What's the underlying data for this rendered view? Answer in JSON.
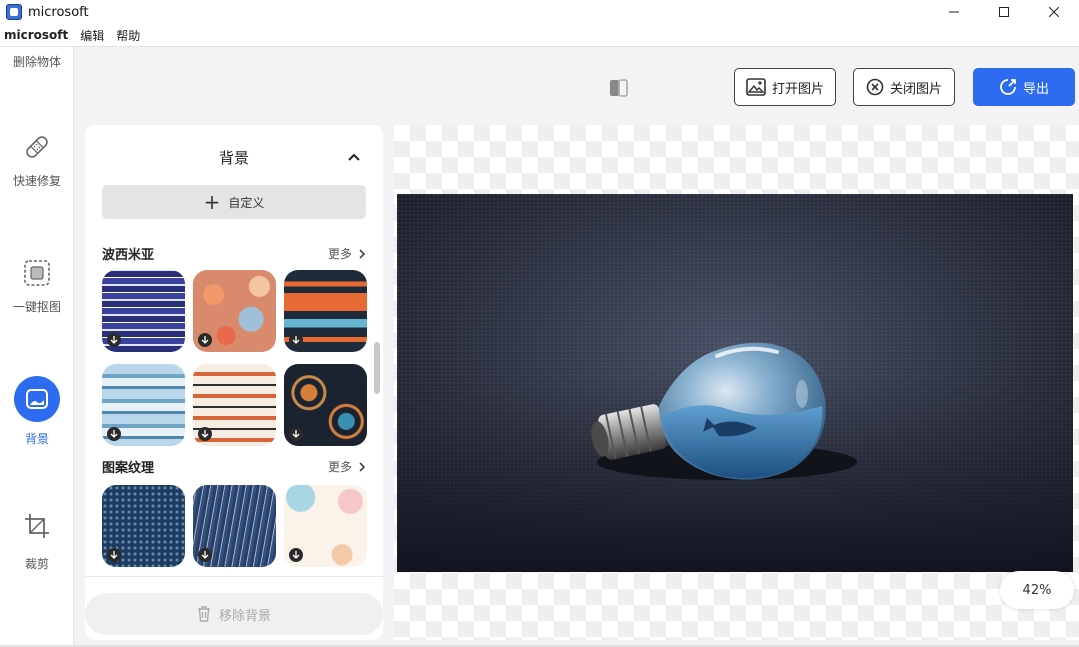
{
  "window": {
    "title": "microsoft"
  },
  "menu": [
    "microsoft",
    "编辑",
    "帮助"
  ],
  "rail": {
    "top_label": "删除物体",
    "items": [
      {
        "label": "快速修复",
        "icon": "bandage-icon"
      },
      {
        "label": "一键抠图",
        "icon": "cutout-icon"
      },
      {
        "label": "背景",
        "icon": "background-icon",
        "active": true
      },
      {
        "label": "裁剪",
        "icon": "crop-icon"
      }
    ]
  },
  "toolbar": {
    "open_label": "打开图片",
    "close_label": "关闭图片",
    "export_label": "导出"
  },
  "panel": {
    "title": "背景",
    "custom_label": "自定义",
    "sections": [
      {
        "title": "波西米亚",
        "more_label": "更多"
      },
      {
        "title": "图案纹理",
        "more_label": "更多"
      }
    ],
    "remove_label": "移除背景"
  },
  "canvas": {
    "zoom": "42%"
  },
  "colors": {
    "accent": "#2d6cf0"
  }
}
